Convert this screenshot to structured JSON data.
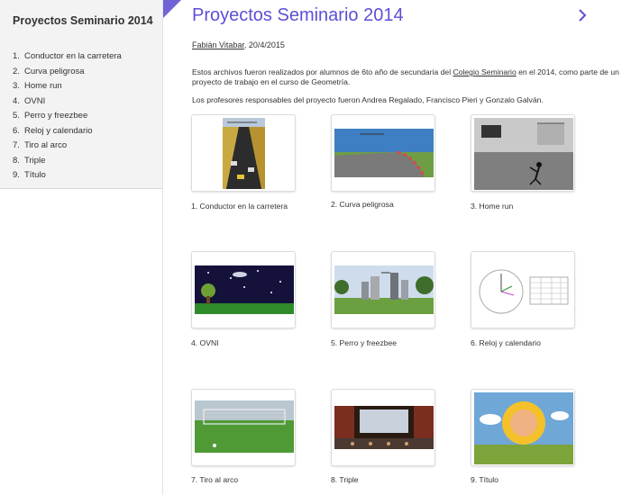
{
  "sidebar": {
    "title": "Proyectos Seminario 2014",
    "items": [
      {
        "num": "1.",
        "label": "Conductor en la carretera"
      },
      {
        "num": "2.",
        "label": "Curva peligrosa"
      },
      {
        "num": "3.",
        "label": "Home run"
      },
      {
        "num": "4.",
        "label": "OVNI"
      },
      {
        "num": "5.",
        "label": "Perro y freezbee"
      },
      {
        "num": "6.",
        "label": "Reloj y calendario"
      },
      {
        "num": "7.",
        "label": "Tiro al arco"
      },
      {
        "num": "8.",
        "label": "Triple"
      },
      {
        "num": "9.",
        "label": "Título"
      }
    ]
  },
  "header": {
    "title": "Proyectos Seminario 2014",
    "next_icon": "chevron-right-icon"
  },
  "byline": {
    "author": "Fabián Vitabar",
    "date": ", 20/4/2015"
  },
  "intro": {
    "p1_before": "Estos archivos fueron realizados por alumnos de 6to año de secundaria del ",
    "p1_link": "Colegio Seminario",
    "p1_after": " en el 2014, como parte de un proyecto de trabajo en el curso de Geometría.",
    "p2": "Los profesores responsables del proyecto fueron Andrea Regalado, Francisco Pieri y Gonzalo Galván."
  },
  "gallery": [
    {
      "caption": "1. Conductor en la carretera"
    },
    {
      "caption": "2. Curva peligrosa"
    },
    {
      "caption": "3. Home run"
    },
    {
      "caption": "4. OVNI"
    },
    {
      "caption": "5. Perro y freezbee"
    },
    {
      "caption": "6. Reloj y calendario"
    },
    {
      "caption": "7. Tiro al arco"
    },
    {
      "caption": "8. Triple"
    },
    {
      "caption": "9. Título"
    }
  ],
  "colors": {
    "accent": "#5b4fd6",
    "sidebar_bg": "#f3f3f3"
  }
}
